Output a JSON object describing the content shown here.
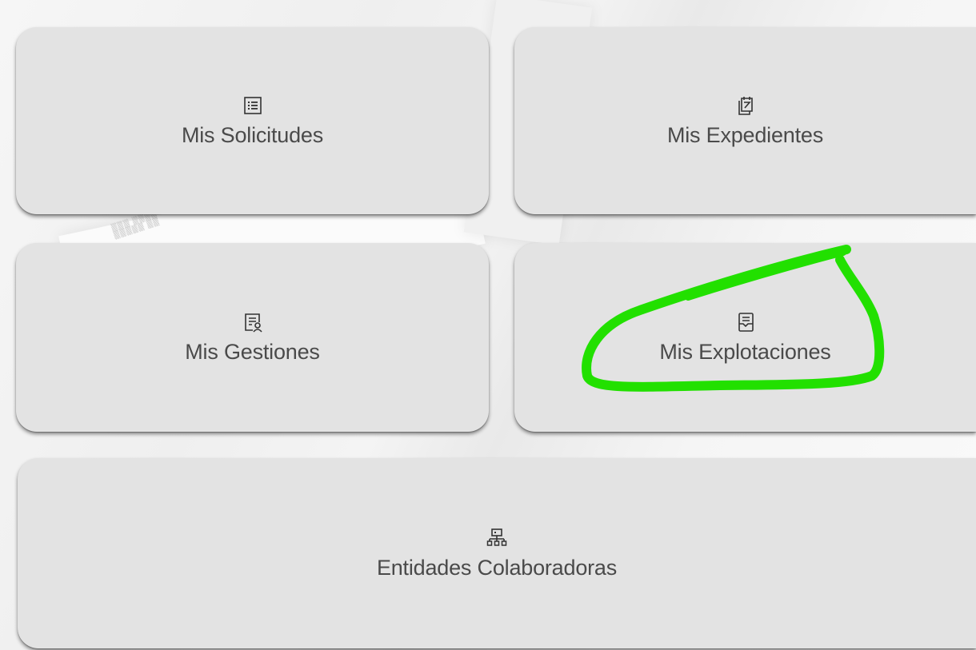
{
  "tiles": {
    "solicitudes": {
      "label": "Mis Solicitudes",
      "icon": "list-icon"
    },
    "expedientes": {
      "label": "Mis Expedientes",
      "icon": "clipboard-docs-icon"
    },
    "gestiones": {
      "label": "Mis Gestiones",
      "icon": "document-user-icon"
    },
    "explotaciones": {
      "label": "Mis Explotaciones",
      "icon": "document-tray-icon"
    },
    "entidades": {
      "label": "Entidades Colaboradoras",
      "icon": "org-chart-icon"
    }
  },
  "colors": {
    "tile_background": "#e3e3e3",
    "label_text": "#4a4a4a",
    "annotation_highlight": "#22e000"
  }
}
